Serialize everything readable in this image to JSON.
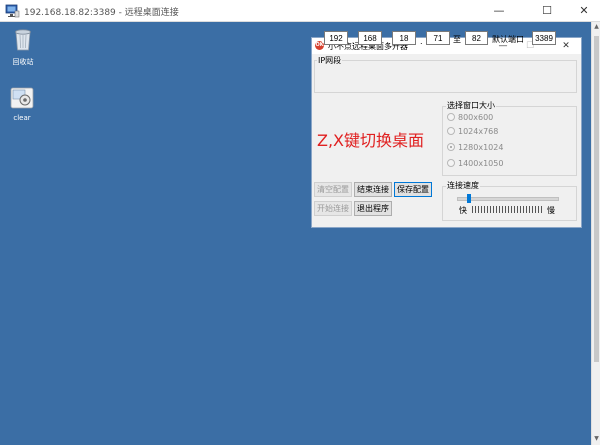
{
  "rdp_window": {
    "title": "192.168.18.82:3389 - 远程桌面连接",
    "controls": {
      "minimize": "—",
      "maximize": "☐",
      "close": "✕"
    }
  },
  "desktop": {
    "icons": [
      {
        "label": "回收站",
        "icon": "recycle-bin-icon"
      },
      {
        "label": "clear",
        "icon": "clear-app-icon"
      }
    ]
  },
  "app": {
    "title": "小不点远程桌面多开器",
    "logo_text": "OK",
    "controls": {
      "minimize": "—",
      "maximize": "☐",
      "close": "✕"
    },
    "ip_group": {
      "label": "IP网段",
      "octet1": "192",
      "octet2": "168",
      "octet3": "18",
      "octet4_start": "71",
      "to_label": "至",
      "octet4_end": "82",
      "port_label": "默认端口",
      "port": "3389"
    },
    "hint_text": "Z,X键切换桌面",
    "window_size_group": {
      "label": "选择窗口大小",
      "options": [
        "800x600",
        "1024x768",
        "1280x1024",
        "1400x1050"
      ],
      "selected": "1280x1024"
    },
    "buttons": {
      "clear_config": "清空配置",
      "end_connection": "结束连接",
      "save_config": "保存配置",
      "start_connection": "开始连接",
      "exit_program": "退出程序"
    },
    "speed_group": {
      "label": "连接速度",
      "fast_label": "快",
      "slow_label": "慢",
      "value_fraction": 0.1
    }
  }
}
